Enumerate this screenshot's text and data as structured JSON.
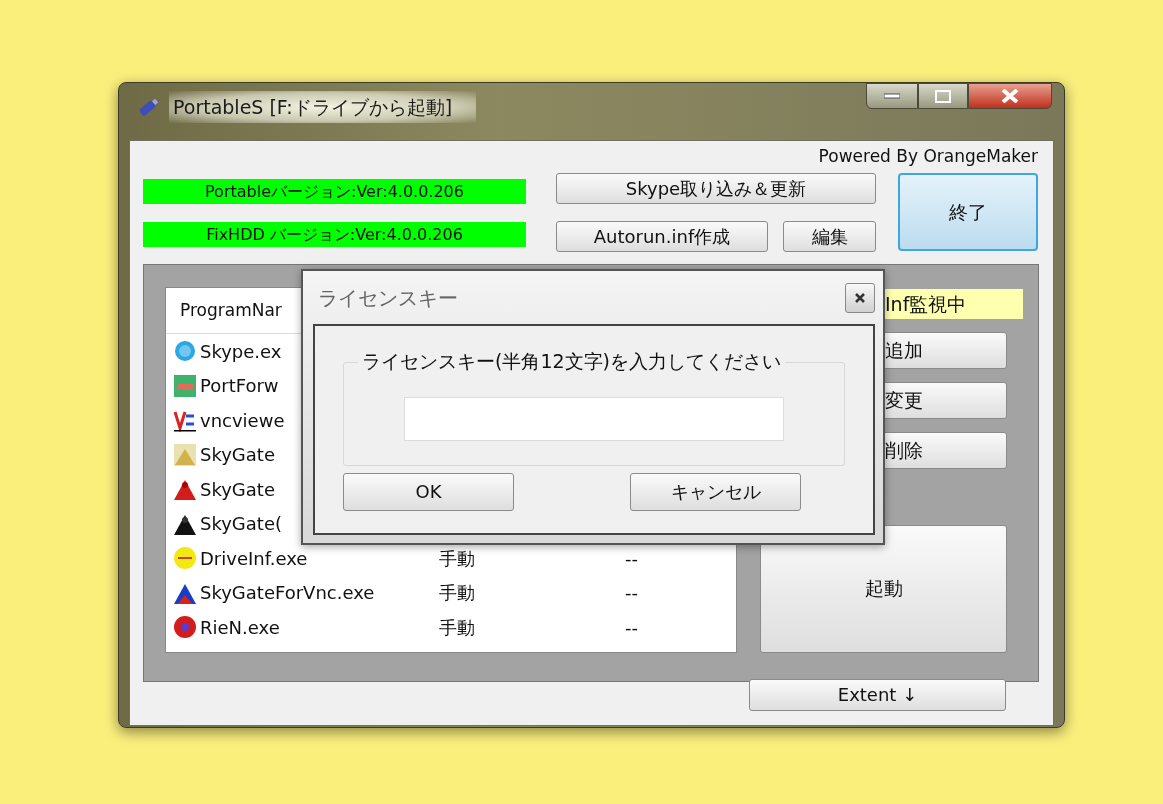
{
  "window": {
    "title": "PortableS [F:ドライブから起動]"
  },
  "powered_by": "Powered By OrangeMaker",
  "version_labels": [
    "Portableバージョン:Ver:4.0.0.206",
    "FixHDD バージョン:Ver:4.0.0.206"
  ],
  "top_buttons": {
    "skype": "Skype取り込み＆更新",
    "autorun": "Autorun.inf作成",
    "edit": "編集",
    "exit": "終了"
  },
  "program_list": {
    "columns": [
      "ProgramNar"
    ],
    "rows": [
      {
        "name": "Skype.ex"
      },
      {
        "name": "PortForw"
      },
      {
        "name": "vncviewe"
      },
      {
        "name": "SkyGate"
      },
      {
        "name": "SkyGate"
      },
      {
        "name": "SkyGate("
      },
      {
        "name": "DriveInf.exe",
        "column_2": "手動",
        "column_3": "--"
      },
      {
        "name": "SkyGateForVnc.exe",
        "column_2": "手動",
        "column_3": "--"
      },
      {
        "name": "RieN.exe",
        "column_2": "手動",
        "column_3": "--"
      }
    ]
  },
  "status_label": "Inf監視中",
  "side_buttons": [
    "追加",
    "変更",
    "削除"
  ],
  "launch_button": "起動",
  "extent_button": "Extent ↓",
  "dialog": {
    "title": "ライセンスキー",
    "group_label": "ライセンスキー(半角12文字)を入力してください",
    "buttons": [
      "OK",
      "キャンセル"
    ]
  }
}
